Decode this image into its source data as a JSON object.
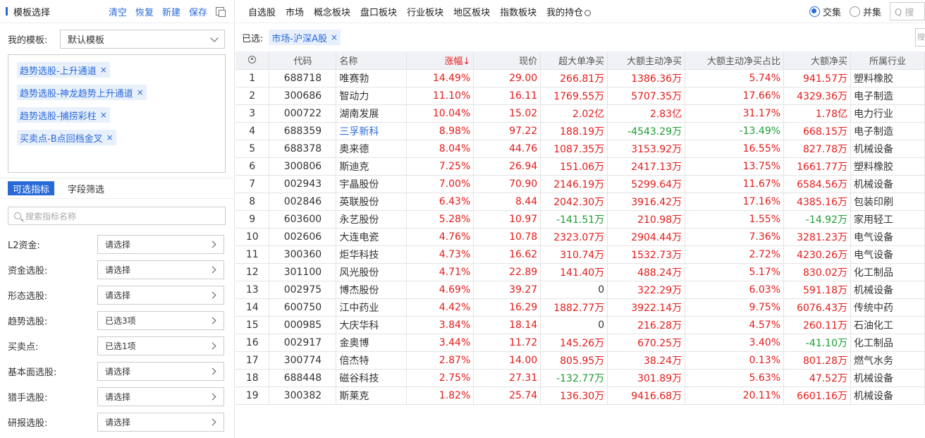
{
  "left": {
    "title": "模板选择",
    "actions": [
      "清空",
      "恢复",
      "新建",
      "保存"
    ],
    "template_label": "我的模板:",
    "template_value": "默认模板",
    "tags": [
      "趋势选股-上升通道",
      "趋势选股-神龙趋势上升通道",
      "趋势选股-捕捞彩柱",
      "买卖点-B点回档金叉"
    ],
    "tabs": [
      "可选指标",
      "字段筛选"
    ],
    "search_placeholder": "搜索指标名称",
    "filters": [
      {
        "label": "L2资金:",
        "value": "请选择"
      },
      {
        "label": "资金选股:",
        "value": "请选择"
      },
      {
        "label": "形态选股:",
        "value": "请选择"
      },
      {
        "label": "趋势选股:",
        "value": "已选3项"
      },
      {
        "label": "买卖点:",
        "value": "已选1项"
      },
      {
        "label": "基本面选股:",
        "value": "请选择"
      },
      {
        "label": "猎手选股:",
        "value": "请选择"
      },
      {
        "label": "研报选股:",
        "value": "请选择"
      }
    ]
  },
  "nav": {
    "items": [
      "自选股",
      "市场",
      "概念板块",
      "盘口板块",
      "行业板块",
      "地区板块",
      "指数板块",
      "我的持仓"
    ],
    "radio_intersect": "交集",
    "radio_union": "并集",
    "search_placeholder": "Q 搜"
  },
  "selected": {
    "label": "已选:",
    "tag": "市场-沪深A股",
    "search_stub": "搜"
  },
  "table": {
    "headers": [
      "",
      "代码",
      "名称",
      "涨幅↓",
      "现价",
      "超大单净买",
      "大额主动净买",
      "大额主动净买占比",
      "大额净买",
      "所属行业"
    ],
    "rows": [
      [
        "1",
        "688718",
        "唯赛勃",
        "14.49%",
        "29.00",
        "266.81万",
        "1386.36万",
        "5.74%",
        "941.57万",
        "塑料橡胶"
      ],
      [
        "2",
        "300686",
        "智动力",
        "11.10%",
        "16.11",
        "1769.55万",
        "5707.35万",
        "17.66%",
        "4329.36万",
        "电子制造"
      ],
      [
        "3",
        "000722",
        "湖南发展",
        "10.04%",
        "15.02",
        "2.02亿",
        "2.83亿",
        "31.17%",
        "1.78亿",
        "电力行业"
      ],
      [
        "4",
        "688359",
        "三孚新科",
        "8.98%",
        "97.22",
        "188.19万",
        "-4543.29万",
        "-13.49%",
        "668.15万",
        "电子制造"
      ],
      [
        "5",
        "688378",
        "奥来德",
        "8.04%",
        "44.76",
        "1087.35万",
        "3153.92万",
        "16.55%",
        "827.78万",
        "机械设备"
      ],
      [
        "6",
        "300806",
        "斯迪克",
        "7.25%",
        "26.94",
        "151.06万",
        "2417.13万",
        "13.75%",
        "1661.77万",
        "塑料橡胶"
      ],
      [
        "7",
        "002943",
        "宇晶股份",
        "7.00%",
        "70.90",
        "2146.19万",
        "5299.64万",
        "11.67%",
        "6584.56万",
        "机械设备"
      ],
      [
        "8",
        "002846",
        "英联股份",
        "6.43%",
        "8.44",
        "2042.30万",
        "3916.42万",
        "17.16%",
        "4385.16万",
        "包装印刷"
      ],
      [
        "9",
        "603600",
        "永艺股份",
        "5.28%",
        "10.97",
        "-141.51万",
        "210.98万",
        "1.55%",
        "-14.92万",
        "家用轻工"
      ],
      [
        "10",
        "002606",
        "大连电瓷",
        "4.76%",
        "10.78",
        "2323.07万",
        "2904.44万",
        "7.36%",
        "3281.23万",
        "电气设备"
      ],
      [
        "11",
        "300360",
        "炬华科技",
        "4.73%",
        "16.62",
        "310.74万",
        "1532.73万",
        "2.72%",
        "4230.26万",
        "电气设备"
      ],
      [
        "12",
        "301100",
        "风光股份",
        "4.71%",
        "22.89",
        "141.40万",
        "488.24万",
        "5.17%",
        "830.02万",
        "化工制品"
      ],
      [
        "13",
        "002975",
        "博杰股份",
        "4.69%",
        "39.27",
        "0",
        "322.29万",
        "6.03%",
        "591.18万",
        "机械设备"
      ],
      [
        "14",
        "600750",
        "江中药业",
        "4.42%",
        "16.29",
        "1882.77万",
        "3922.14万",
        "9.75%",
        "6076.43万",
        "传统中药"
      ],
      [
        "15",
        "000985",
        "大庆华科",
        "3.84%",
        "18.14",
        "0",
        "216.28万",
        "4.57%",
        "260.11万",
        "石油化工"
      ],
      [
        "16",
        "002917",
        "金奥博",
        "3.44%",
        "11.72",
        "145.26万",
        "670.25万",
        "3.40%",
        "-41.10万",
        "化工制品"
      ],
      [
        "17",
        "300774",
        "倍杰特",
        "2.87%",
        "14.00",
        "805.95万",
        "38.24万",
        "0.13%",
        "801.28万",
        "燃气水务"
      ],
      [
        "18",
        "688448",
        "磁谷科技",
        "2.75%",
        "27.31",
        "-132.77万",
        "301.89万",
        "5.63%",
        "47.52万",
        "机械设备"
      ],
      [
        "19",
        "300382",
        "斯莱克",
        "1.82%",
        "25.74",
        "136.30万",
        "9416.68万",
        "20.11%",
        "6601.16万",
        "机械设备"
      ]
    ],
    "highlight_name_row": 3
  },
  "colors": {
    "accent": "#2a6ad8",
    "up": "#e61a1a",
    "down": "#1a9e32",
    "header_bg": "#f0f2f5"
  }
}
